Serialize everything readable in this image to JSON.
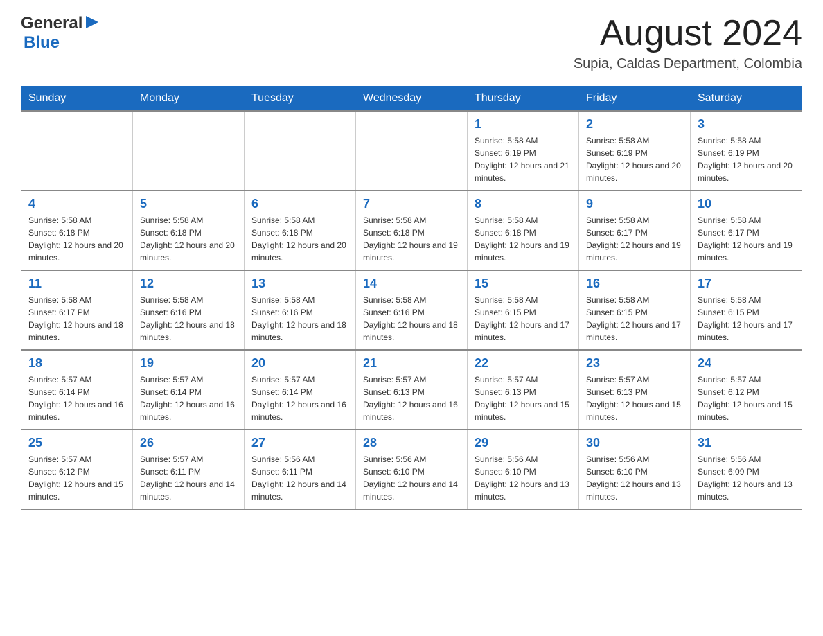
{
  "header": {
    "logo": {
      "general_text": "General",
      "blue_text": "Blue"
    },
    "title": "August 2024",
    "location": "Supia, Caldas Department, Colombia"
  },
  "calendar": {
    "days_of_week": [
      "Sunday",
      "Monday",
      "Tuesday",
      "Wednesday",
      "Thursday",
      "Friday",
      "Saturday"
    ],
    "weeks": [
      [
        {
          "day": "",
          "info": ""
        },
        {
          "day": "",
          "info": ""
        },
        {
          "day": "",
          "info": ""
        },
        {
          "day": "",
          "info": ""
        },
        {
          "day": "1",
          "info": "Sunrise: 5:58 AM\nSunset: 6:19 PM\nDaylight: 12 hours and 21 minutes."
        },
        {
          "day": "2",
          "info": "Sunrise: 5:58 AM\nSunset: 6:19 PM\nDaylight: 12 hours and 20 minutes."
        },
        {
          "day": "3",
          "info": "Sunrise: 5:58 AM\nSunset: 6:19 PM\nDaylight: 12 hours and 20 minutes."
        }
      ],
      [
        {
          "day": "4",
          "info": "Sunrise: 5:58 AM\nSunset: 6:18 PM\nDaylight: 12 hours and 20 minutes."
        },
        {
          "day": "5",
          "info": "Sunrise: 5:58 AM\nSunset: 6:18 PM\nDaylight: 12 hours and 20 minutes."
        },
        {
          "day": "6",
          "info": "Sunrise: 5:58 AM\nSunset: 6:18 PM\nDaylight: 12 hours and 20 minutes."
        },
        {
          "day": "7",
          "info": "Sunrise: 5:58 AM\nSunset: 6:18 PM\nDaylight: 12 hours and 19 minutes."
        },
        {
          "day": "8",
          "info": "Sunrise: 5:58 AM\nSunset: 6:18 PM\nDaylight: 12 hours and 19 minutes."
        },
        {
          "day": "9",
          "info": "Sunrise: 5:58 AM\nSunset: 6:17 PM\nDaylight: 12 hours and 19 minutes."
        },
        {
          "day": "10",
          "info": "Sunrise: 5:58 AM\nSunset: 6:17 PM\nDaylight: 12 hours and 19 minutes."
        }
      ],
      [
        {
          "day": "11",
          "info": "Sunrise: 5:58 AM\nSunset: 6:17 PM\nDaylight: 12 hours and 18 minutes."
        },
        {
          "day": "12",
          "info": "Sunrise: 5:58 AM\nSunset: 6:16 PM\nDaylight: 12 hours and 18 minutes."
        },
        {
          "day": "13",
          "info": "Sunrise: 5:58 AM\nSunset: 6:16 PM\nDaylight: 12 hours and 18 minutes."
        },
        {
          "day": "14",
          "info": "Sunrise: 5:58 AM\nSunset: 6:16 PM\nDaylight: 12 hours and 18 minutes."
        },
        {
          "day": "15",
          "info": "Sunrise: 5:58 AM\nSunset: 6:15 PM\nDaylight: 12 hours and 17 minutes."
        },
        {
          "day": "16",
          "info": "Sunrise: 5:58 AM\nSunset: 6:15 PM\nDaylight: 12 hours and 17 minutes."
        },
        {
          "day": "17",
          "info": "Sunrise: 5:58 AM\nSunset: 6:15 PM\nDaylight: 12 hours and 17 minutes."
        }
      ],
      [
        {
          "day": "18",
          "info": "Sunrise: 5:57 AM\nSunset: 6:14 PM\nDaylight: 12 hours and 16 minutes."
        },
        {
          "day": "19",
          "info": "Sunrise: 5:57 AM\nSunset: 6:14 PM\nDaylight: 12 hours and 16 minutes."
        },
        {
          "day": "20",
          "info": "Sunrise: 5:57 AM\nSunset: 6:14 PM\nDaylight: 12 hours and 16 minutes."
        },
        {
          "day": "21",
          "info": "Sunrise: 5:57 AM\nSunset: 6:13 PM\nDaylight: 12 hours and 16 minutes."
        },
        {
          "day": "22",
          "info": "Sunrise: 5:57 AM\nSunset: 6:13 PM\nDaylight: 12 hours and 15 minutes."
        },
        {
          "day": "23",
          "info": "Sunrise: 5:57 AM\nSunset: 6:13 PM\nDaylight: 12 hours and 15 minutes."
        },
        {
          "day": "24",
          "info": "Sunrise: 5:57 AM\nSunset: 6:12 PM\nDaylight: 12 hours and 15 minutes."
        }
      ],
      [
        {
          "day": "25",
          "info": "Sunrise: 5:57 AM\nSunset: 6:12 PM\nDaylight: 12 hours and 15 minutes."
        },
        {
          "day": "26",
          "info": "Sunrise: 5:57 AM\nSunset: 6:11 PM\nDaylight: 12 hours and 14 minutes."
        },
        {
          "day": "27",
          "info": "Sunrise: 5:56 AM\nSunset: 6:11 PM\nDaylight: 12 hours and 14 minutes."
        },
        {
          "day": "28",
          "info": "Sunrise: 5:56 AM\nSunset: 6:10 PM\nDaylight: 12 hours and 14 minutes."
        },
        {
          "day": "29",
          "info": "Sunrise: 5:56 AM\nSunset: 6:10 PM\nDaylight: 12 hours and 13 minutes."
        },
        {
          "day": "30",
          "info": "Sunrise: 5:56 AM\nSunset: 6:10 PM\nDaylight: 12 hours and 13 minutes."
        },
        {
          "day": "31",
          "info": "Sunrise: 5:56 AM\nSunset: 6:09 PM\nDaylight: 12 hours and 13 minutes."
        }
      ]
    ]
  }
}
